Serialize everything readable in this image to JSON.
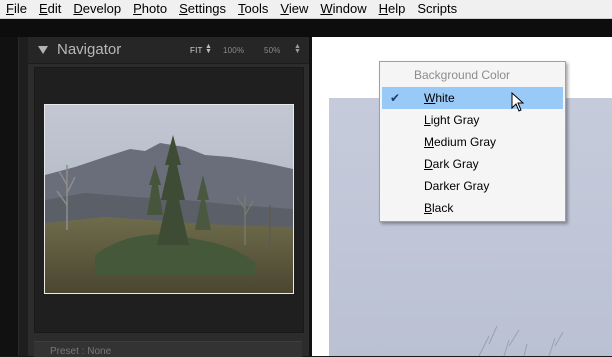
{
  "menubar": {
    "items": [
      {
        "label": "File",
        "accel": "F",
        "rest": "ile"
      },
      {
        "label": "Edit",
        "accel": "E",
        "rest": "dit"
      },
      {
        "label": "Develop",
        "accel": "D",
        "rest": "evelop"
      },
      {
        "label": "Photo",
        "accel": "P",
        "rest": "hoto"
      },
      {
        "label": "Settings",
        "accel": "S",
        "rest": "ettings"
      },
      {
        "label": "Tools",
        "accel": "T",
        "rest": "ools"
      },
      {
        "label": "View",
        "accel": "V",
        "rest": "iew"
      },
      {
        "label": "Window",
        "accel": "W",
        "rest": "indow"
      },
      {
        "label": "Help",
        "accel": "H",
        "rest": "elp"
      },
      {
        "label": "Scripts",
        "accel": "",
        "rest": "Scripts"
      }
    ]
  },
  "navigator": {
    "title": "Navigator",
    "zoom_fit": "FIT",
    "zoom_100": "100%",
    "zoom_50": "50%",
    "fit_arrows": "▲\n▼",
    "zoom_arrows": "▲\n▼"
  },
  "preset_strip": {
    "text": "Preset :   None"
  },
  "context_menu": {
    "header": "Background Color",
    "items": [
      {
        "label": "White",
        "accel": "W",
        "rest": "hite",
        "selected": true
      },
      {
        "label": "Light Gray",
        "accel": "L",
        "rest": "ight Gray",
        "selected": false
      },
      {
        "label": "Medium Gray",
        "accel": "M",
        "rest": "edium Gray",
        "selected": false
      },
      {
        "label": "Dark Gray",
        "accel": "D",
        "rest": "ark Gray",
        "selected": false
      },
      {
        "label": "Darker Gray",
        "accel": "",
        "rest": "Darker Gray",
        "selected": false
      },
      {
        "label": "Black",
        "accel": "B",
        "rest": "lack",
        "selected": false
      }
    ],
    "check_glyph": "✔"
  },
  "colors": {
    "menu_highlight": "#99c9f7",
    "canvas_background": "#ffffff",
    "panel_background": "#2c2c2c"
  },
  "icons": {
    "panel_collapse": "triangle-down-icon",
    "check": "checkmark-icon",
    "cursor": "mouse-pointer-icon"
  }
}
